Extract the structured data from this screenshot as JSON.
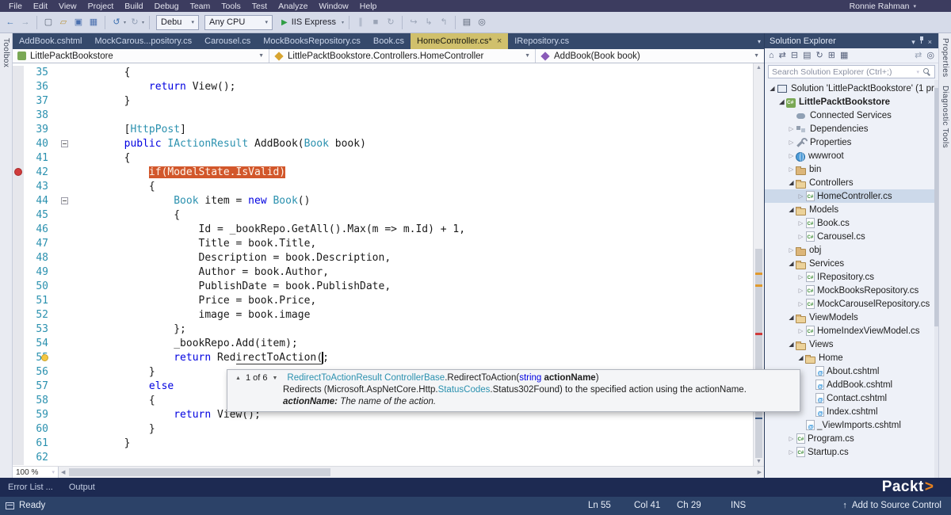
{
  "menu_bar": {
    "items": [
      "File",
      "Edit",
      "View",
      "Project",
      "Build",
      "Debug",
      "Team",
      "Tools",
      "Test",
      "Analyze",
      "Window",
      "Help"
    ],
    "user": "Ronnie Rahman"
  },
  "toolbar": {
    "left_icons": [
      "nav-back-icon",
      "nav-forward-icon",
      "sep",
      "new-file-icon",
      "open-file-icon",
      "save-icon",
      "save-all-icon",
      "sep",
      "undo-icon",
      "dd",
      "redo-icon",
      "dd",
      "sep"
    ],
    "config_label": "Debu",
    "platform_label": "Any CPU",
    "run_label": "IIS Express",
    "right_icons": [
      "dd",
      "sep",
      "pause-icon",
      "stop-icon",
      "restart-icon",
      "sep",
      "step-over-icon",
      "step-into-icon",
      "step-out-icon",
      "sep",
      "solution-config-icon",
      "attach-icon"
    ]
  },
  "doc_tabs": [
    {
      "label": "AddBook.cshtml",
      "active": false
    },
    {
      "label": "MockCarous...pository.cs",
      "active": false
    },
    {
      "label": "Carousel.cs",
      "active": false
    },
    {
      "label": "MockBooksRepository.cs",
      "active": false
    },
    {
      "label": "Book.cs",
      "active": false
    },
    {
      "label": "HomeController.cs*",
      "active": true
    },
    {
      "label": "IRepository.cs",
      "active": false
    }
  ],
  "breadcrumb": {
    "project": "LittlePacktBookstore",
    "class": "LittlePacktBookstore.Controllers.HomeController",
    "member": "AddBook(Book book)"
  },
  "editor": {
    "zoom": "100 %",
    "lines": [
      {
        "num": 35,
        "tokens": [
          {
            "c": "p",
            "t": "        {"
          }
        ]
      },
      {
        "num": 36,
        "tokens": [
          {
            "c": "p",
            "t": "            "
          },
          {
            "c": "k",
            "t": "return"
          },
          {
            "c": "p",
            "t": " View();"
          }
        ]
      },
      {
        "num": 37,
        "tokens": [
          {
            "c": "p",
            "t": "        }"
          }
        ]
      },
      {
        "num": 38,
        "tokens": []
      },
      {
        "num": 39,
        "tokens": [
          {
            "c": "p",
            "t": "        ["
          },
          {
            "c": "t",
            "t": "HttpPost"
          },
          {
            "c": "p",
            "t": "]"
          }
        ]
      },
      {
        "num": 40,
        "fold": true,
        "tokens": [
          {
            "c": "p",
            "t": "        "
          },
          {
            "c": "k",
            "t": "public"
          },
          {
            "c": "p",
            "t": " "
          },
          {
            "c": "t",
            "t": "IActionResult"
          },
          {
            "c": "p",
            "t": " AddBook("
          },
          {
            "c": "t",
            "t": "Book"
          },
          {
            "c": "p",
            "t": " book)"
          }
        ]
      },
      {
        "num": 41,
        "tokens": [
          {
            "c": "p",
            "t": "        {"
          }
        ]
      },
      {
        "num": 42,
        "breakpoint": true,
        "tokens": [
          {
            "c": "p",
            "t": "            "
          },
          {
            "c": "hl",
            "t": "if(ModelState.IsValid)"
          }
        ]
      },
      {
        "num": 43,
        "tokens": [
          {
            "c": "p",
            "t": "            {"
          }
        ]
      },
      {
        "num": 44,
        "fold": true,
        "tokens": [
          {
            "c": "p",
            "t": "                "
          },
          {
            "c": "t",
            "t": "Book"
          },
          {
            "c": "p",
            "t": " item = "
          },
          {
            "c": "k",
            "t": "new"
          },
          {
            "c": "p",
            "t": " "
          },
          {
            "c": "t",
            "t": "Book"
          },
          {
            "c": "p",
            "t": "()"
          }
        ]
      },
      {
        "num": 45,
        "tokens": [
          {
            "c": "p",
            "t": "                {"
          }
        ]
      },
      {
        "num": 46,
        "tokens": [
          {
            "c": "p",
            "t": "                    Id = _bookRepo.GetAll().Max(m => m.Id) + 1,"
          }
        ]
      },
      {
        "num": 47,
        "tokens": [
          {
            "c": "p",
            "t": "                    Title = book.Title,"
          }
        ]
      },
      {
        "num": 48,
        "tokens": [
          {
            "c": "p",
            "t": "                    Description = book.Description,"
          }
        ]
      },
      {
        "num": 49,
        "tokens": [
          {
            "c": "p",
            "t": "                    Author = book.Author,"
          }
        ]
      },
      {
        "num": 50,
        "tokens": [
          {
            "c": "p",
            "t": "                    PublishDate = book.PublishDate,"
          }
        ]
      },
      {
        "num": 51,
        "tokens": [
          {
            "c": "p",
            "t": "                    Price = book.Price,"
          }
        ]
      },
      {
        "num": 52,
        "tokens": [
          {
            "c": "p",
            "t": "                    image = book.image"
          }
        ]
      },
      {
        "num": 53,
        "tokens": [
          {
            "c": "p",
            "t": "                };"
          }
        ]
      },
      {
        "num": 54,
        "tokens": [
          {
            "c": "p",
            "t": "                _bookRepo.Add(item);"
          }
        ]
      },
      {
        "num": 55,
        "bulb": true,
        "tokens": [
          {
            "c": "p",
            "t": "                "
          },
          {
            "c": "k",
            "t": "return"
          },
          {
            "c": "p",
            "t": " Red"
          },
          {
            "c": "u",
            "t": "irectToAction("
          },
          {
            "c": "caret",
            "t": ""
          },
          {
            "c": "p",
            "t": ";"
          }
        ]
      },
      {
        "num": 56,
        "tokens": [
          {
            "c": "p",
            "t": "            }"
          }
        ]
      },
      {
        "num": 57,
        "tokens": [
          {
            "c": "p",
            "t": "            "
          },
          {
            "c": "k",
            "t": "else"
          }
        ]
      },
      {
        "num": 58,
        "tokens": [
          {
            "c": "p",
            "t": "            {"
          }
        ]
      },
      {
        "num": 59,
        "tokens": [
          {
            "c": "p",
            "t": "                "
          },
          {
            "c": "k",
            "t": "return"
          },
          {
            "c": "p",
            "t": " View();"
          }
        ]
      },
      {
        "num": 60,
        "tokens": [
          {
            "c": "p",
            "t": "            }"
          }
        ]
      },
      {
        "num": 61,
        "tokens": [
          {
            "c": "p",
            "t": "        }"
          }
        ]
      },
      {
        "num": 62,
        "tokens": []
      }
    ]
  },
  "tooltip": {
    "pager": "1 of 6",
    "sig": [
      {
        "c": "t",
        "t": "RedirectToActionResult"
      },
      {
        "c": "p",
        "t": " "
      },
      {
        "c": "t",
        "t": "ControllerBase"
      },
      {
        "c": "p",
        "t": ".RedirectToAction("
      },
      {
        "c": "k",
        "t": "string"
      },
      {
        "c": "b",
        "t": " actionName"
      },
      {
        "c": "p",
        "t": ")"
      }
    ],
    "desc": [
      {
        "c": "p",
        "t": "Redirects (Microsoft.AspNetCore.Http."
      },
      {
        "c": "t",
        "t": "StatusCodes"
      },
      {
        "c": "p",
        "t": ".Status302Found) to the specified action using the actionName."
      }
    ],
    "param_name": "actionName:",
    "param_desc": " The name of the action."
  },
  "solution_explorer": {
    "title": "Solution Explorer",
    "header_icons": [
      "chevron-down-icon",
      "pin-icon",
      "close-icon"
    ],
    "toolbar_icons": [
      "home-icon",
      "switch-view-icon",
      "collapse-all-icon",
      "show-all-files-icon",
      "refresh-icon",
      "new-folder-icon",
      "properties-icon",
      "gap",
      "sync-icon",
      "preview-code-icon"
    ],
    "search_placeholder": "Search Solution Explorer (Ctrl+;)",
    "tree": [
      {
        "label": "Solution 'LittlePacktBookstore' (1 pr",
        "depth": 0,
        "exp": "expanded",
        "icon": "solution"
      },
      {
        "label": "LittlePacktBookstore",
        "depth": 1,
        "exp": "expanded",
        "icon": "project",
        "bold": true
      },
      {
        "label": "Connected Services",
        "depth": 2,
        "exp": "none",
        "icon": "services"
      },
      {
        "label": "Dependencies",
        "depth": 2,
        "exp": "collapsed",
        "icon": "dependencies"
      },
      {
        "label": "Properties",
        "depth": 2,
        "exp": "collapsed",
        "icon": "wrench"
      },
      {
        "label": "wwwroot",
        "depth": 2,
        "exp": "collapsed",
        "icon": "globe"
      },
      {
        "label": "bin",
        "depth": 2,
        "exp": "collapsed",
        "icon": "folder"
      },
      {
        "label": "Controllers",
        "depth": 2,
        "exp": "expanded",
        "icon": "folder-open"
      },
      {
        "label": "HomeController.cs",
        "depth": 3,
        "exp": "collapsed",
        "icon": "cs",
        "selected": true
      },
      {
        "label": "Models",
        "depth": 2,
        "exp": "expanded",
        "icon": "folder-open"
      },
      {
        "label": "Book.cs",
        "depth": 3,
        "exp": "collapsed",
        "icon": "cs"
      },
      {
        "label": "Carousel.cs",
        "depth": 3,
        "exp": "collapsed",
        "icon": "cs"
      },
      {
        "label": "obj",
        "depth": 2,
        "exp": "collapsed",
        "icon": "folder"
      },
      {
        "label": "Services",
        "depth": 2,
        "exp": "expanded",
        "icon": "folder-open"
      },
      {
        "label": "IRepository.cs",
        "depth": 3,
        "exp": "collapsed",
        "icon": "cs"
      },
      {
        "label": "MockBooksRepository.cs",
        "depth": 3,
        "exp": "collapsed",
        "icon": "cs"
      },
      {
        "label": "MockCarouselRepository.cs",
        "depth": 3,
        "exp": "collapsed",
        "icon": "cs"
      },
      {
        "label": "ViewModels",
        "depth": 2,
        "exp": "expanded",
        "icon": "folder-open"
      },
      {
        "label": "HomeIndexViewModel.cs",
        "depth": 3,
        "exp": "collapsed",
        "icon": "cs"
      },
      {
        "label": "Views",
        "depth": 2,
        "exp": "expanded",
        "icon": "folder-open"
      },
      {
        "label": "Home",
        "depth": 3,
        "exp": "expanded",
        "icon": "folder-open"
      },
      {
        "label": "About.cshtml",
        "depth": 4,
        "exp": "none",
        "icon": "cshtml"
      },
      {
        "label": "AddBook.cshtml",
        "depth": 4,
        "exp": "none",
        "icon": "cshtml"
      },
      {
        "label": "Contact.cshtml",
        "depth": 4,
        "exp": "none",
        "icon": "cshtml"
      },
      {
        "label": "Index.cshtml",
        "depth": 4,
        "exp": "none",
        "icon": "cshtml"
      },
      {
        "label": "_ViewImports.cshtml",
        "depth": 3,
        "exp": "none",
        "icon": "cshtml"
      },
      {
        "label": "Program.cs",
        "depth": 2,
        "exp": "collapsed",
        "icon": "cs"
      },
      {
        "label": "Startup.cs",
        "depth": 2,
        "exp": "collapsed",
        "icon": "cs"
      }
    ]
  },
  "side_tabs": {
    "left": [
      "Toolbox"
    ],
    "right": [
      "Properties",
      "Diagnostic Tools"
    ]
  },
  "bottom_panel": {
    "tabs": [
      "Error List ...",
      "Output"
    ],
    "brand": "Packt",
    "brand_arrow": ">"
  },
  "status_bar": {
    "state": "Ready",
    "line": "Ln 55",
    "col": "Col 41",
    "ch": "Ch 29",
    "mode": "INS",
    "source_control": "Add to Source Control"
  }
}
